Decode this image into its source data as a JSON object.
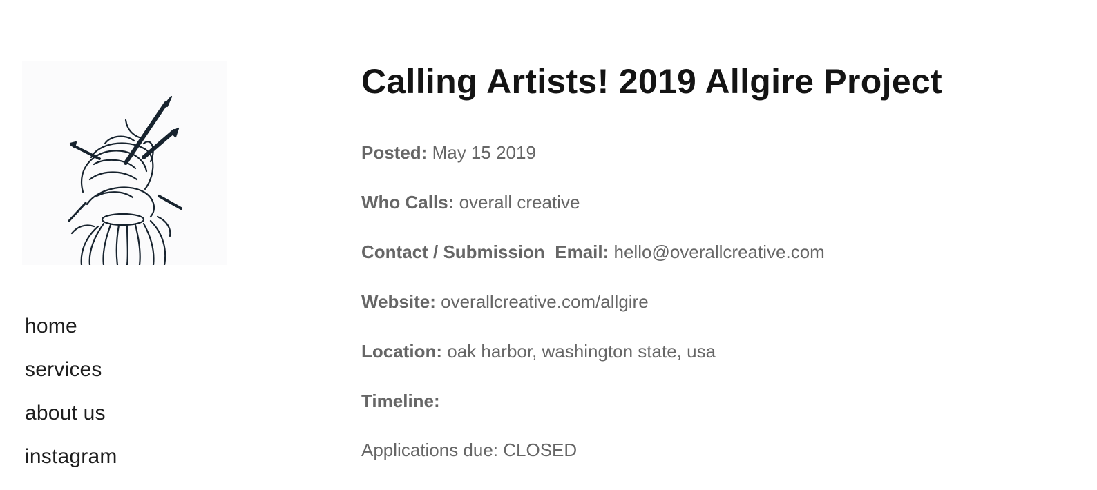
{
  "logo": {
    "icon": "hair-bun-paintbrush-illustration",
    "background": "#fbfbfc",
    "ink": "#17232e"
  },
  "nav": [
    {
      "label": "home"
    },
    {
      "label": "services"
    },
    {
      "label": "about us"
    },
    {
      "label": "instagram"
    }
  ],
  "post": {
    "title": "Calling Artists! 2019 Allgire Project",
    "posted_label": "Posted:",
    "posted_value": "May 15 2019",
    "who_label": "Who Calls:",
    "who_value": "overall creative",
    "contact_label": "Contact / Submission  Email:",
    "contact_value": "hello@overallcreative.com",
    "website_label": "Website:",
    "website_value": "overallcreative.com/allgire",
    "location_label": "Location:",
    "location_value": "oak harbor, washington state, usa",
    "timeline_label": "Timeline:",
    "applications_text": "Applications due: CLOSED"
  },
  "colors": {
    "title": "#141414",
    "body_text": "#666666",
    "nav_text": "#1e1e1e"
  }
}
